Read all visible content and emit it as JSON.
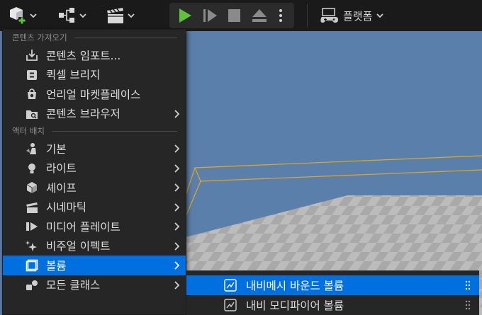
{
  "toolbar": {
    "icons": [
      "add-content-icon",
      "blueprint-icon",
      "cinematics-icon",
      "play-icon",
      "step-icon",
      "stop-icon",
      "eject-icon",
      "more-icon",
      "controller-icon"
    ],
    "platform_label": "플랫폼"
  },
  "menu": {
    "section_import": "콘텐츠 가져오기",
    "import_items": [
      {
        "label": "콘텐츠 임포트..."
      },
      {
        "label": "퀵셀 브리지"
      },
      {
        "label": "언리얼 마켓플레이스"
      },
      {
        "label": "콘텐츠 브라우저"
      }
    ],
    "section_place": "액터 배치",
    "place_items": [
      {
        "label": "기본"
      },
      {
        "label": "라이트"
      },
      {
        "label": "셰이프"
      },
      {
        "label": "시네마틱"
      },
      {
        "label": "미디어 플레이트"
      },
      {
        "label": "비주얼 이펙트"
      },
      {
        "label": "볼륨"
      },
      {
        "label": "모든 클래스"
      }
    ]
  },
  "submenu": {
    "items": [
      {
        "label": "내비메시 바운드 볼륨"
      },
      {
        "label": "내비 모디파이어 볼륨"
      }
    ]
  },
  "colors": {
    "accent": "#0070e0",
    "play": "#5ec33a",
    "sky": "#5b7fab",
    "selection_outline": "#e7a61f"
  }
}
